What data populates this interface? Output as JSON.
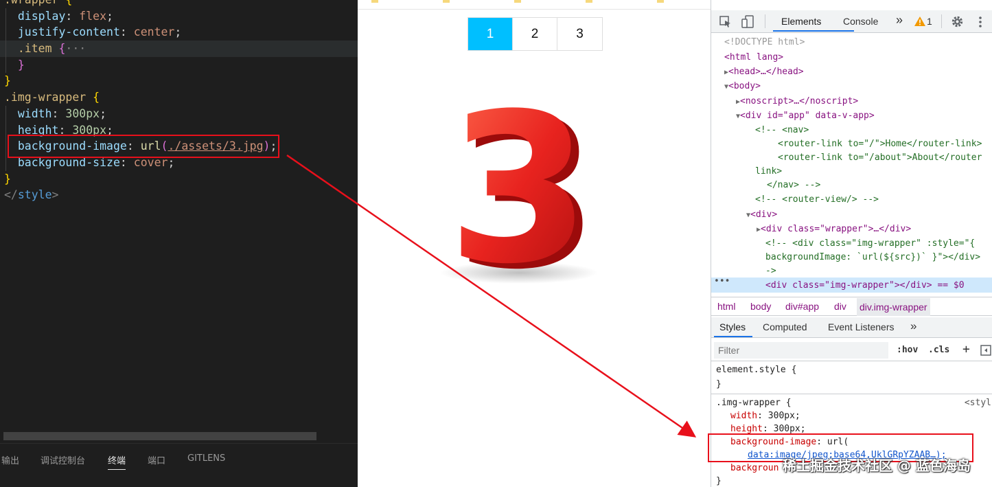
{
  "editor": {
    "lines": [
      {
        "sel": ".wrapper",
        "brace": "{"
      },
      {
        "prop": "display",
        "val": "flex"
      },
      {
        "prop": "justify-content",
        "val": "center"
      },
      {
        "sel": ".item",
        "brace": "{",
        "fold": "···"
      },
      {
        "brace": "}"
      },
      {
        "brace": "}"
      },
      {
        "sel": ".img-wrapper",
        "brace": "{"
      },
      {
        "prop": "width",
        "num": "300px"
      },
      {
        "prop": "height",
        "num": "300px"
      },
      {
        "prop": "background-image",
        "fn": "url",
        "url": "./assets/3.jpg"
      },
      {
        "prop": "background-size",
        "val": "cover"
      },
      {
        "brace": "}"
      },
      {
        "tag": "style"
      }
    ],
    "panel_tabs": [
      "输出",
      "调试控制台",
      "终端",
      "端口",
      "GITLENS"
    ],
    "active_panel_tab": "终端"
  },
  "preview": {
    "pager": [
      "1",
      "2",
      "3"
    ],
    "active_page": "1",
    "image_digit": "3",
    "image_color": "#e8231f"
  },
  "devtools": {
    "tabs": [
      "Elements",
      "Console"
    ],
    "active_tab": "Elements",
    "more": "»",
    "warning_count": "1",
    "dom_lines": [
      "<!DOCTYPE html>",
      "<html lang>",
      "<head>…</head>",
      "<body>",
      "<noscript>…</noscript>",
      "<div id=\"app\" data-v-app>",
      "<!-- <nav>",
      "<router-link to=\"/\">Home</router-link>",
      "<router-link to=\"/about\">About</router",
      "link>",
      "</nav> -->",
      "<!-- <router-view/> -->",
      "<div>",
      "<div class=\"wrapper\">…</div>",
      "<!-- <div class=\"img-wrapper\" :style=\"{",
      "backgroundImage: `url(${src})` }\"></div>",
      "->",
      "<div class=\"img-wrapper\"></div> == $0"
    ],
    "breadcrumbs": [
      "html",
      "body",
      "div#app",
      "div",
      "div.img-wrapper"
    ],
    "styles_tabs": [
      "Styles",
      "Computed",
      "Event Listeners",
      "»"
    ],
    "filter_placeholder": "Filter",
    "filter_tools": [
      ":hov",
      ".cls",
      "+"
    ],
    "element_style": "element.style {",
    "element_style_close": "}",
    "rule_selector": ".img-wrapper {",
    "rule_source": "<styl",
    "rule_props": [
      {
        "name": "width",
        "value": "300px;"
      },
      {
        "name": "height",
        "value": "300px;"
      },
      {
        "name": "background-image",
        "value": "url("
      },
      {
        "name": "",
        "value": "data:image/jpeg;base64,UklGRpYZAAB…);"
      },
      {
        "name": "backgroun",
        "value": ""
      }
    ],
    "rule_close": "}"
  },
  "colors": {
    "annotation": "#e8101b",
    "active_page_bg": "#00bfff"
  },
  "watermark": "稀土掘金技术社区 @ 蓝色海岛"
}
